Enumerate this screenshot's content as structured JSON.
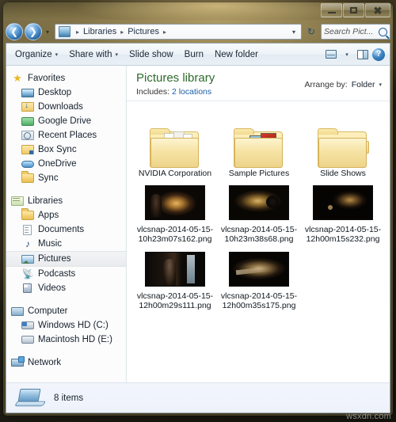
{
  "window": {
    "minimize_label": "Minimize",
    "maximize_label": "Maximize",
    "close_label": "Close"
  },
  "address_bar": {
    "back_icon": "back-arrow-icon",
    "forward_icon": "forward-arrow-icon",
    "history_caret": "▾",
    "location_icon": "library-icon",
    "crumbs": [
      "Libraries",
      "Pictures"
    ],
    "separator": "▸",
    "dropdown_caret": "▾",
    "refresh_icon": "↻"
  },
  "search": {
    "placeholder": "Search Pict...",
    "icon": "search-icon"
  },
  "toolbar": {
    "organize_label": "Organize",
    "share_with_label": "Share with",
    "slide_show_label": "Slide show",
    "burn_label": "Burn",
    "new_folder_label": "New folder",
    "caret": "▾",
    "view_icon": "change-view-icon",
    "preview_pane_icon": "preview-pane-icon",
    "help_label": "?"
  },
  "sidebar": {
    "groups": [
      {
        "header": {
          "label": "Favorites",
          "icon": "star-icon"
        },
        "items": [
          {
            "label": "Desktop",
            "icon": "desktop-icon"
          },
          {
            "label": "Downloads",
            "icon": "downloads-icon"
          },
          {
            "label": "Google Drive",
            "icon": "google-drive-icon"
          },
          {
            "label": "Recent Places",
            "icon": "recent-places-icon"
          },
          {
            "label": "Box Sync",
            "icon": "box-sync-icon"
          },
          {
            "label": "OneDrive",
            "icon": "onedrive-icon"
          },
          {
            "label": "Sync",
            "icon": "folder-icon"
          }
        ]
      },
      {
        "header": {
          "label": "Libraries",
          "icon": "libraries-icon"
        },
        "items": [
          {
            "label": "Apps",
            "icon": "folder-icon"
          },
          {
            "label": "Documents",
            "icon": "documents-icon"
          },
          {
            "label": "Music",
            "icon": "music-icon"
          },
          {
            "label": "Pictures",
            "icon": "pictures-icon",
            "selected": true
          },
          {
            "label": "Podcasts",
            "icon": "podcasts-icon"
          },
          {
            "label": "Videos",
            "icon": "videos-icon"
          }
        ]
      },
      {
        "header": {
          "label": "Computer",
          "icon": "computer-icon"
        },
        "items": [
          {
            "label": "Windows HD (C:)",
            "icon": "hard-drive-icon"
          },
          {
            "label": "Macintosh HD (E:)",
            "icon": "hard-drive-icon"
          }
        ]
      },
      {
        "header": {
          "label": "Network",
          "icon": "network-icon"
        },
        "items": []
      }
    ]
  },
  "library_header": {
    "title": "Pictures library",
    "includes_label": "Includes:",
    "locations_link": "2 locations",
    "arrange_by_label": "Arrange by:",
    "arrange_by_value": "Folder",
    "caret": "▾"
  },
  "items": [
    {
      "name": "NVIDIA Corporation",
      "type": "folder",
      "icon": "folder-multi-icon"
    },
    {
      "name": "Sample Pictures",
      "type": "folder",
      "icon": "folder-photos-icon"
    },
    {
      "name": "Slide Shows",
      "type": "folder",
      "icon": "folder-icon"
    },
    {
      "name": "vlcsnap-2014-05-15-10h23m07s162.png",
      "type": "file",
      "icon": "image-thumbnail"
    },
    {
      "name": "vlcsnap-2014-05-15-10h23m38s68.png",
      "type": "file",
      "icon": "image-thumbnail"
    },
    {
      "name": "vlcsnap-2014-05-15-12h00m15s232.png",
      "type": "file",
      "icon": "image-thumbnail"
    },
    {
      "name": "vlcsnap-2014-05-15-12h00m29s111.png",
      "type": "file",
      "icon": "image-thumbnail"
    },
    {
      "name": "vlcsnap-2014-05-15-12h00m35s175.png",
      "type": "file",
      "icon": "image-thumbnail"
    }
  ],
  "status_bar": {
    "item_count": "8 items",
    "icon": "computer-icon"
  },
  "watermark": "wsxdn.com",
  "colors": {
    "library_title": "#2d6a2d",
    "link": "#1b5fa8",
    "frame": "#8e7f52"
  }
}
